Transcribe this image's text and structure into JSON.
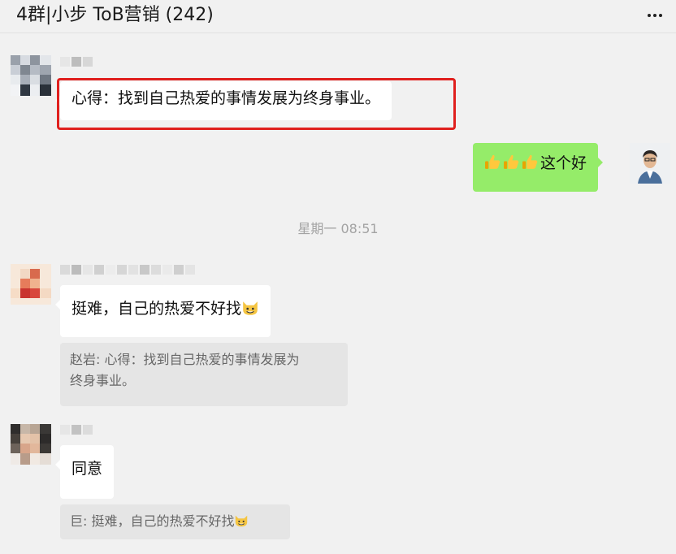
{
  "header": {
    "title": "4群|小步 ToB营销  (242)",
    "more_icon": "more-dots-icon"
  },
  "messages": [
    {
      "side": "left",
      "text": "心得：找到自己热爱的事情发展为终身事业。",
      "highlighted": true,
      "highlight_color": "#e0201e"
    },
    {
      "side": "right",
      "emoji": [
        "thumbs-up-icon",
        "thumbs-up-icon",
        "thumbs-up-icon"
      ],
      "text": "这个好"
    },
    {
      "timestamp": "星期一 08:51"
    },
    {
      "side": "left",
      "text": "挺难，自己的热爱不好找",
      "emoji": "grinning-cat-icon",
      "quote_line1": "赵岩: 心得：找到自己热爱的事情发展为",
      "quote_line2": "终身事业。"
    },
    {
      "side": "left",
      "text": "同意",
      "quote_text": "巨: 挺难，自己的热爱不好找",
      "quote_emoji": "grinning-cat-icon"
    }
  ],
  "colors": {
    "background": "#f1f1f1",
    "bubble_left": "#ffffff",
    "bubble_right": "#95ec69",
    "quote_bg": "#e5e5e5",
    "timestamp": "#a3a3a3"
  }
}
